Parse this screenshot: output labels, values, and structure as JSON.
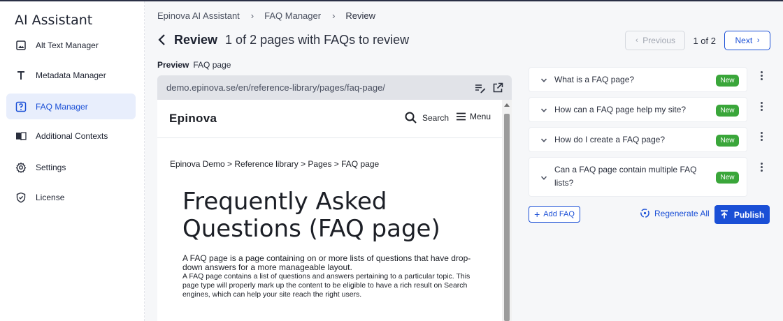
{
  "sidebar": {
    "app_title": "AI Assistant",
    "items": [
      {
        "label": "Alt Text Manager",
        "icon": "image-icon"
      },
      {
        "label": "Metadata Manager",
        "icon": "text-t-icon"
      },
      {
        "label": "FAQ Manager",
        "icon": "faq-help-icon",
        "active": true
      },
      {
        "label": "Additional Contexts",
        "icon": "book-open-icon"
      },
      {
        "label": "Settings",
        "icon": "gear-icon"
      },
      {
        "label": "License",
        "icon": "shield-check-icon"
      }
    ]
  },
  "breadcrumb": [
    "Epinova AI Assistant",
    "FAQ Manager",
    "Review"
  ],
  "header": {
    "title": "Review",
    "subtitle": "1 of 2 pages with FAQs to review"
  },
  "pager": {
    "previous_label": "Previous",
    "count": "1 of 2",
    "next_label": "Next"
  },
  "preview": {
    "label": "Preview",
    "page_name": "FAQ page",
    "url": "demo.epinova.se/en/reference-library/pages/faq-page/",
    "site": {
      "logo": "Epinova",
      "search_label": "Search",
      "menu_label": "Menu",
      "crumbs": "Epinova Demo >  Reference library >  Pages >  FAQ page",
      "heading": "Frequently Asked Questions (FAQ page)",
      "lead": "A FAQ page is a page containing on or more lists of questions that have drop-down answers for a more manageable layout.",
      "body": "A FAQ page contains a list of questions and answers pertaining to a particular topic. This page type will properly mark up the content to be eligible to have  a rich result on Search engines, which can help your site reach the right users."
    }
  },
  "faqs": [
    {
      "question": "What is a FAQ page?",
      "badge": "New"
    },
    {
      "question": "How can a FAQ page help my site?",
      "badge": "New"
    },
    {
      "question": "How do I create a FAQ page?",
      "badge": "New"
    },
    {
      "question": "Can a FAQ page contain multiple FAQ lists?",
      "badge": "New"
    }
  ],
  "actions": {
    "add_label": "Add FAQ",
    "regenerate_label": "Regenerate All",
    "publish_label": "Publish"
  },
  "colors": {
    "accent": "#1a4fd6",
    "badge_new": "#3aa63a",
    "active_nav_bg": "#e8eefc"
  }
}
